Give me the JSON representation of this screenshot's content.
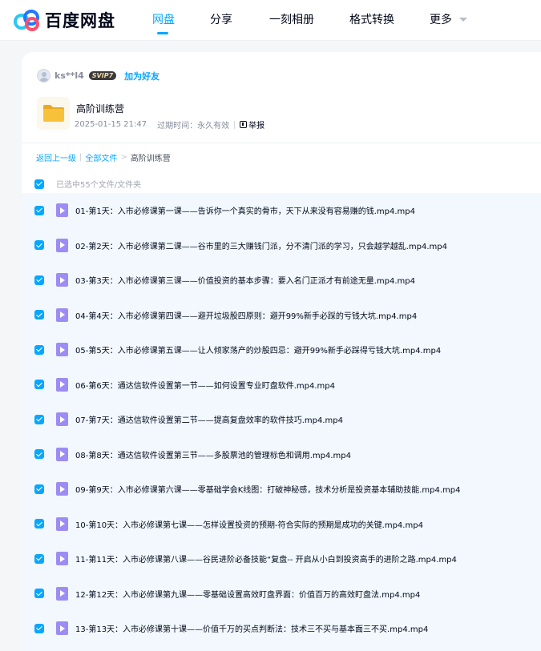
{
  "app": {
    "logo_text": "百度网盘"
  },
  "nav": {
    "items": [
      {
        "label": "网盘",
        "active": true
      },
      {
        "label": "分享",
        "active": false
      },
      {
        "label": "一刻相册",
        "active": false
      },
      {
        "label": "格式转换",
        "active": false
      },
      {
        "label": "更多",
        "active": false
      }
    ]
  },
  "share": {
    "user": "ks**l4",
    "badge": "SVIP7",
    "add_friend": "加为好友",
    "folder_name": "高阶训练营",
    "date": "2025-01-15 21:47",
    "expiry": "过期时间：永久有效",
    "report": "举报"
  },
  "breadcrumb": {
    "back": "返回上一级",
    "separator": "|",
    "all_files": "全部文件",
    "arrow": ">",
    "current": "高阶训练营"
  },
  "selection": {
    "summary": "已选中55个文件/文件夹"
  },
  "files": [
    "01-第1天：入市必修课第一课——告诉你一个真实的骨市，天下从来没有容易赚的钱.mp4.mp4",
    "02-第2天：入市必修课第二课——谷市里的三大赚钱门派，分不清门派的学习，只会越学越乱.mp4.mp4",
    "03-第3天：入市必修课第三课——价值投资的基本步骤：要入名门正派才有前途无量.mp4.mp4",
    "04-第4天：入市必修课第四课——避开垃圾股四原则：避开99%新手必踩的亏钱大坑.mp4.mp4",
    "05-第5天：入市必修课第五课——让人倾家荡产的炒股四忌：避开99%新手必踩得亏钱大坑.mp4.mp4",
    "06-第6天：通达信软件设置第一节——如何设置专业盯盘软件.mp4.mp4",
    "07-第7天：通达信软件设置第二节——提高复盘效率的软件技巧.mp4.mp4",
    "08-第8天：通达信软件设置第三节——多股票池的管理标色和调用.mp4.mp4",
    "09-第9天：入市必修课第六课——零基础学会K线图：打破神秘感，技术分析是投资基本辅助技能.mp4.mp4",
    "10-第10天：入市必修课第七课——怎样设置投资的预期-符合实际的预期是成功的关键.mp4.mp4",
    "11-第11天：入市必修课第八课——谷民进阶必备技能“复盘-- 开启从小白到投资高手的进阶之路.mp4.mp4",
    "12-第12天：入市必修课第九课——零基础设置高效盯盘界面：价值百万的高效盯盘法.mp4.mp4",
    "13-第13天：入市必修课第十课——价值千万的买点判断法：技术三不买与基本面三不买.mp4.mp4"
  ],
  "colors": {
    "accent": "#06a7ff",
    "video_icon": "#9d8cf3",
    "folder": "#f7c13a"
  }
}
